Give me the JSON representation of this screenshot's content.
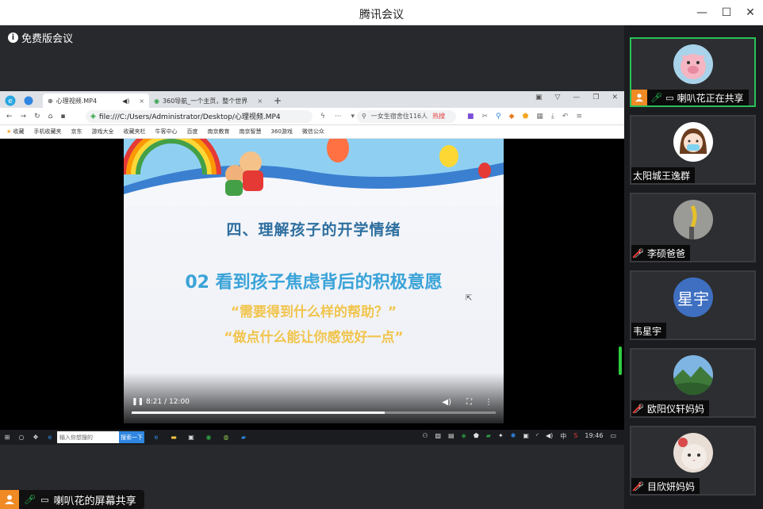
{
  "window": {
    "title": "腾讯会议"
  },
  "controls": {
    "minimize": "—",
    "maximize": "☐",
    "close": "✕"
  },
  "stage": {
    "badge": "免费版会议"
  },
  "browser": {
    "tabs": [
      {
        "label": "心理视频.MP4",
        "close": "×"
      },
      {
        "label": "360导航_一个主页，整个世界",
        "close": "×"
      }
    ],
    "new_tab": "+",
    "url": "file:///C:/Users/Administrator/Desktop/心理视频.MP4",
    "search_placeholder": "一女生宿舍住116人",
    "search_hot": "热搜",
    "bookmarks": [
      "收藏",
      "手机收藏夹",
      "京东",
      "游戏大全",
      "收藏夹栏",
      "牛客中心",
      "百度",
      "南京教育",
      "南京智慧",
      "360游戏",
      "微信公众"
    ]
  },
  "slide": {
    "title": "四、理解孩子的开学情绪",
    "subtitle": "02 看到孩子焦虑背后的积极意愿",
    "quote1": "“需要得到什么样的帮助？”",
    "quote2": "“做点什么能让你感觉好一点”"
  },
  "player": {
    "time": "8:21 / 12:00",
    "progress_fraction": 0.6958
  },
  "taskbar": {
    "search_placeholder": "输入你想搜的",
    "search_button": "搜索一下",
    "clock": "19:46",
    "lang": "中"
  },
  "sharer": {
    "label": "喇叭花的屏幕共享"
  },
  "participants": [
    {
      "name": "喇叭花正在共享",
      "avatar": "pig",
      "mic": "on",
      "sharing": true,
      "active": true
    },
    {
      "name": "太阳城王逸群",
      "avatar": "girl",
      "mic": "none",
      "sharing": false,
      "active": false
    },
    {
      "name": "李硕爸爸",
      "avatar": "banana",
      "mic": "muted",
      "sharing": false,
      "active": false
    },
    {
      "name": "韦星宇",
      "avatar_text": "星宇",
      "avatar": "text",
      "mic": "none",
      "sharing": false,
      "active": false
    },
    {
      "name": "欧阳仪轩妈妈",
      "avatar": "landscape",
      "mic": "muted",
      "sharing": false,
      "active": false
    },
    {
      "name": "目欣妍妈妈",
      "avatar": "cat",
      "mic": "muted",
      "sharing": false,
      "active": false
    }
  ],
  "colors": {
    "accent_green": "#29c05a",
    "slide_title": "#2e6f9f",
    "slide_sub": "#3aa3d8",
    "slide_quote": "#f1c44c"
  }
}
